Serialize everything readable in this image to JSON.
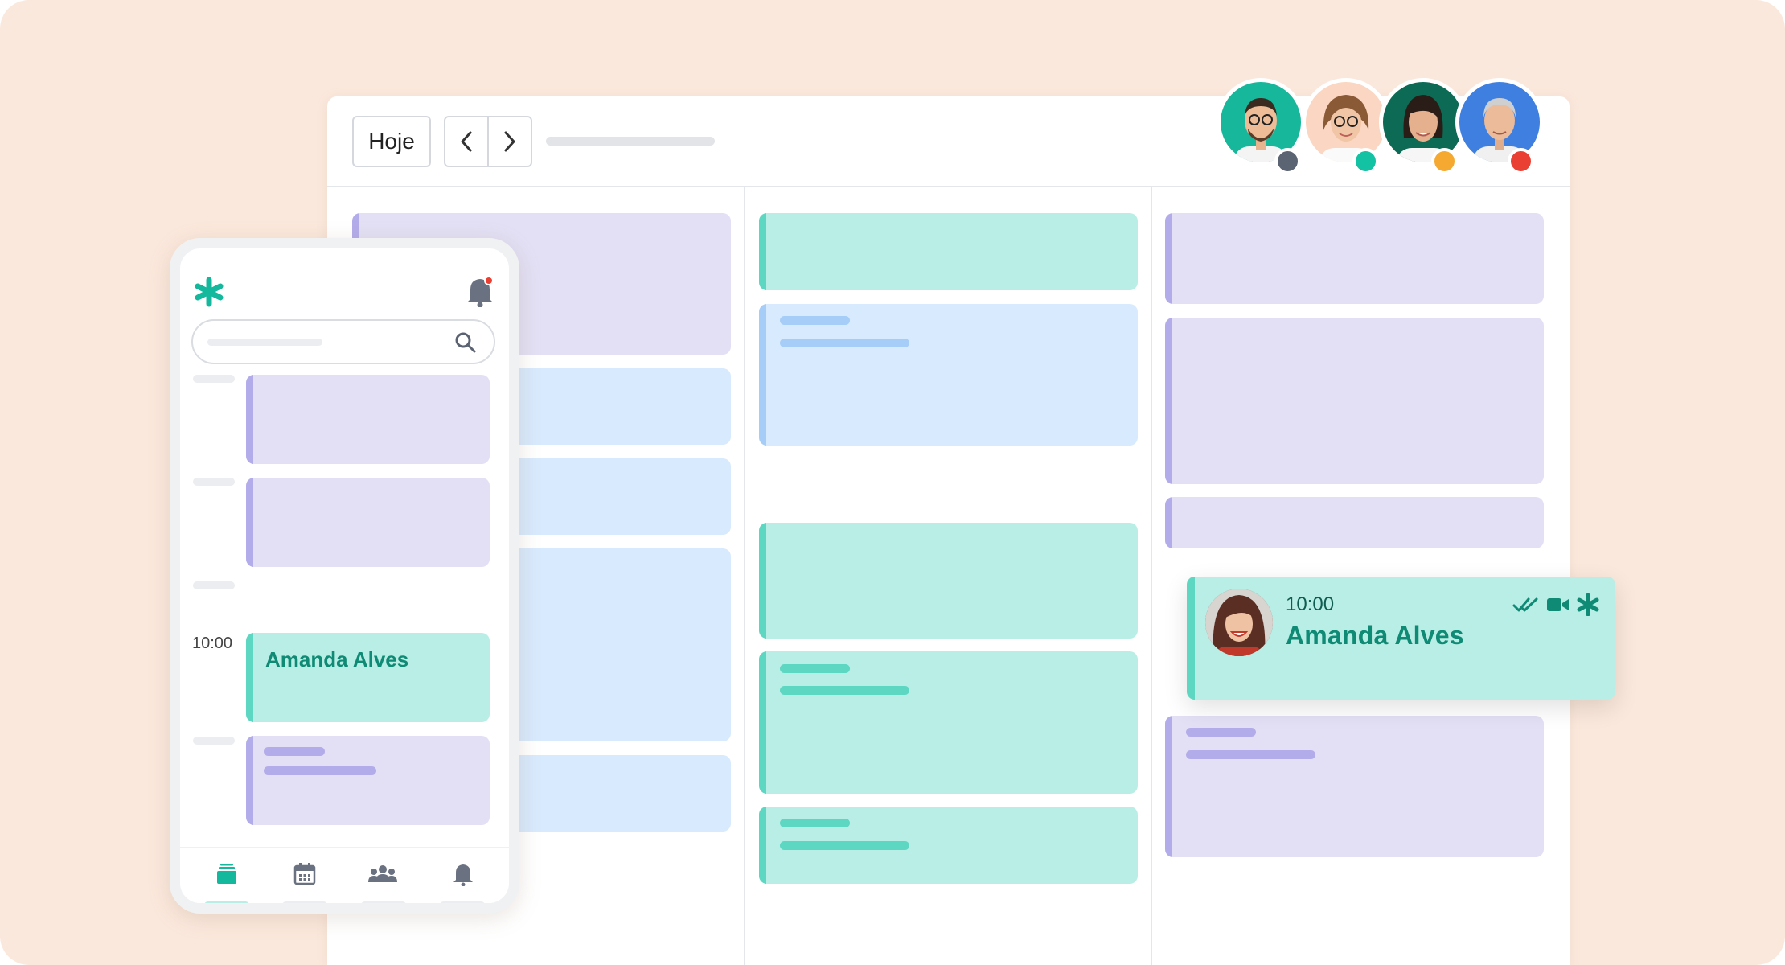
{
  "toolbar": {
    "today_label": "Hoje"
  },
  "mobile": {
    "time_label": "10:00",
    "appointment_name": "Amanda Alves",
    "tabs": [
      {
        "icon": "agenda-icon",
        "active": true
      },
      {
        "icon": "calendar-icon",
        "active": false
      },
      {
        "icon": "patients-icon",
        "active": false
      },
      {
        "icon": "bell-icon",
        "active": false
      }
    ]
  },
  "appointment_card": {
    "time": "10:00",
    "name": "Amanda Alves",
    "icons": [
      "double-check-icon",
      "video-icon",
      "doctoralia-logo-icon"
    ]
  },
  "professionals": [
    {
      "status_color": "#5b6472"
    },
    {
      "status_color": "#13c1a3"
    },
    {
      "status_color": "#f6a930"
    },
    {
      "status_color": "#ea4033"
    }
  ],
  "colors": {
    "accent": "#13b89d",
    "purple_event": "#e3e0f5",
    "blue_event": "#d8eafd",
    "teal_event": "#b9eee6",
    "background": "#fbe8dc"
  }
}
